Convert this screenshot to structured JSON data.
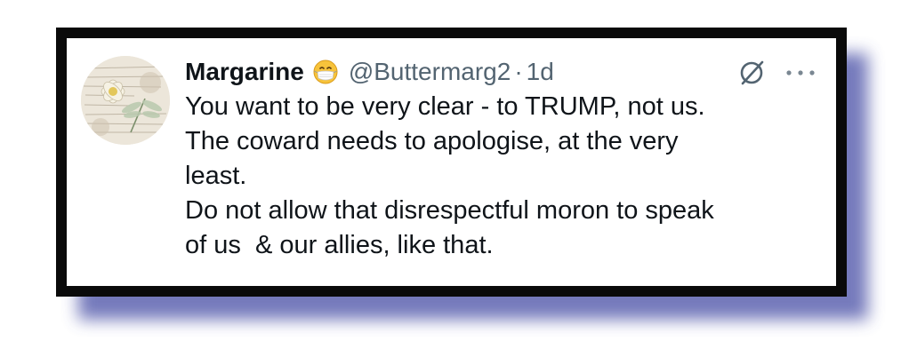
{
  "tweet": {
    "display_name": "Margarine",
    "emoji_icon": "face-with-medical-mask-emoji",
    "handle": "@Buttermarg2",
    "separator": "·",
    "time": "1d",
    "grok_icon": "grok-slash-icon",
    "more_icon": "more-horizontal-icon",
    "lines": [
      "You want to be very clear - to TRUMP, not us.",
      "The coward needs to apologise, at the very",
      "least.",
      "Do not allow that disrespectful moron to speak",
      "of us  & our allies, like that."
    ]
  },
  "colors": {
    "frame": "#0a0a0a",
    "shadow": "#5d63b0",
    "text": "#0f1419",
    "secondary_text": "#536471"
  }
}
